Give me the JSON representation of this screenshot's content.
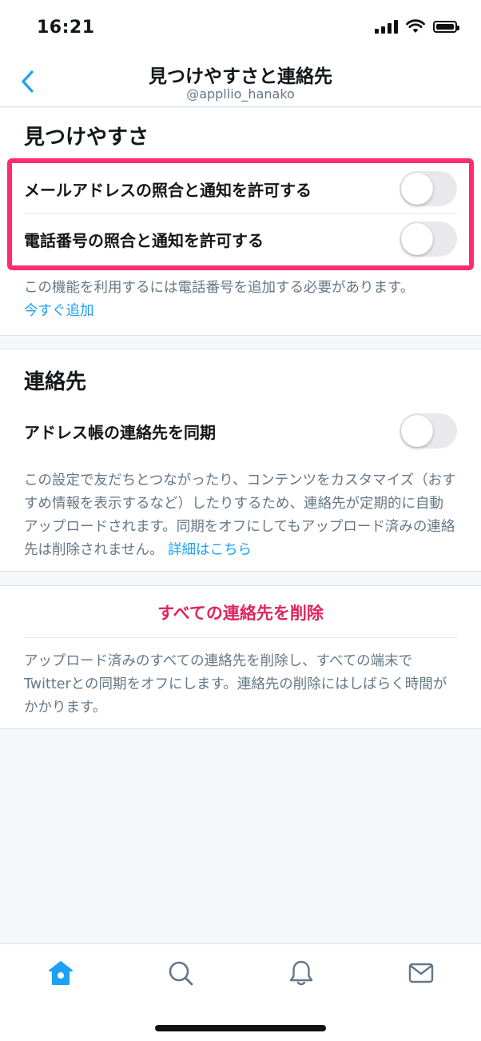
{
  "status_bar": {
    "time": "16:21"
  },
  "header": {
    "title": "見つけやすさと連絡先",
    "username": "@appllio_hanako"
  },
  "discoverability": {
    "heading": "見つけやすさ",
    "email_toggle_label": "メールアドレスの照合と通知を許可する",
    "email_toggle_on": false,
    "phone_toggle_label": "電話番号の照合と通知を許可する",
    "phone_toggle_on": false,
    "note": "この機能を利用するには電話番号を追加する必要があります。",
    "add_now_link": "今すぐ追加"
  },
  "contacts": {
    "heading": "連絡先",
    "sync_label": "アドレス帳の連絡先を同期",
    "sync_on": false,
    "note": "この設定で友だちとつながったり、コンテンツをカスタマイズ（おすすめ情報を表示するなど）したりするため、連絡先が定期的に自動アップロードされます。同期をオフにしてもアップロード済みの連絡先は削除されません。",
    "details_link": "詳細はこちら"
  },
  "delete": {
    "button_label": "すべての連絡先を削除",
    "note": "アップロード済みのすべての連絡先を削除し、すべての端末でTwitterとの同期をオフにします。連絡先の削除にはしばらく時間がかかります。"
  },
  "tab_bar": {
    "tabs": [
      "home-icon",
      "search-icon",
      "notifications-icon",
      "messages-icon"
    ],
    "active": "home-icon"
  },
  "colors": {
    "accent_blue": "#1da1f2",
    "delete_red": "#e0245e",
    "highlight": "#ff2d6f",
    "muted_text": "#657786"
  }
}
